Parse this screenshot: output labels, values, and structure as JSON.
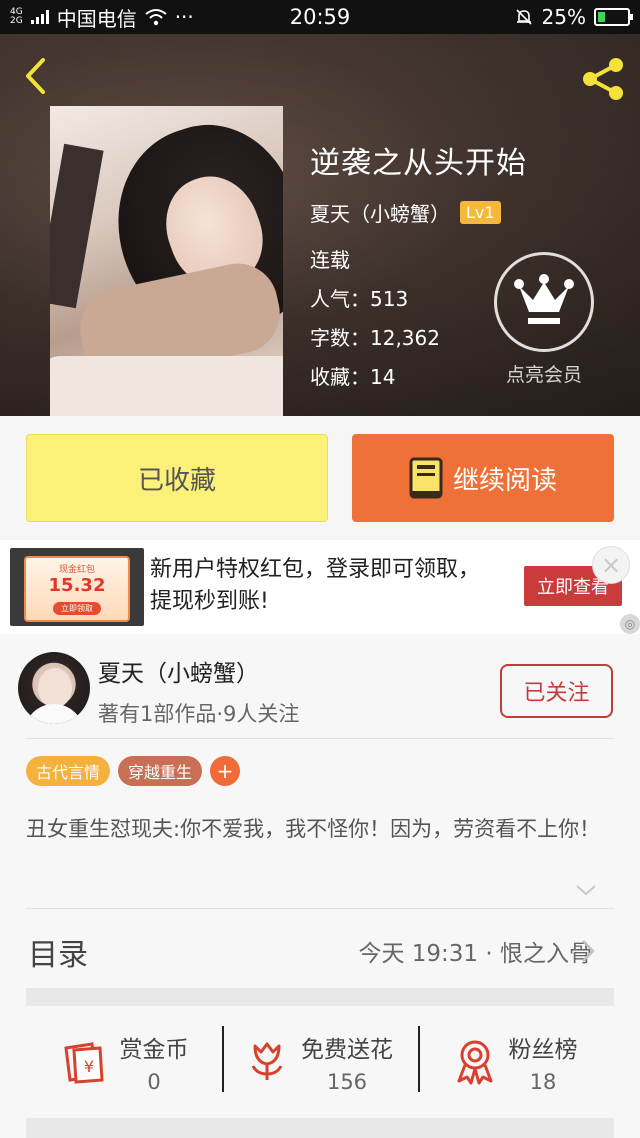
{
  "status_bar": {
    "network_top": "4G",
    "network_bottom": "2G",
    "carrier": "中国电信",
    "more": "···",
    "time": "20:59",
    "battery": "25%",
    "battery_level": 0.25
  },
  "book": {
    "title": "逆袭之从头开始",
    "author": "夏天（小螃蟹）",
    "level": "Lv1",
    "status": "连载",
    "popularity": "人气：513",
    "word_count": "字数：12,362",
    "favorites": "收藏：14"
  },
  "vip": {
    "label": "点亮会员"
  },
  "actions": {
    "favorited_label": "已收藏",
    "continue_label": "继续阅读"
  },
  "ad": {
    "image_small": "现金红包",
    "image_amount": "15.32",
    "image_pill": "立即领取",
    "text": "新用户特权红包，登录即可领取，提现秒到账!",
    "button": "立即查看"
  },
  "author": {
    "name": "夏天（小螃蟹）",
    "summary": "著有1部作品·9人关注",
    "follow_label": "已关注"
  },
  "tags": [
    {
      "label": "古代言情",
      "color": "#f4b23c"
    },
    {
      "label": "穿越重生",
      "color": "#c96f55"
    }
  ],
  "tag_add": "+",
  "synopsis": "丑女重生怼现夫:你不爱我，我不怪你！因为，劳资看不上你！",
  "toc": {
    "label": "目录",
    "latest": "今天 19:31 · 恨之入骨"
  },
  "stats": [
    {
      "name": "赏金币",
      "value": "0",
      "icon": "red-envelope-icon"
    },
    {
      "name": "免费送花",
      "value": "156",
      "icon": "flower-icon"
    },
    {
      "name": "粉丝榜",
      "value": "18",
      "icon": "award-ribbon-icon"
    }
  ],
  "colors": {
    "accent_orange": "#f07138",
    "fav_yellow": "#fbf179",
    "follow_red": "#c63a3a",
    "icon_red": "#d9412e"
  }
}
